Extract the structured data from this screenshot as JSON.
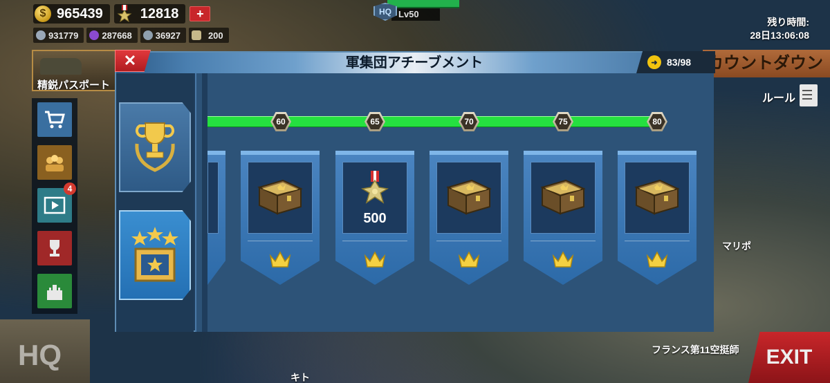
{
  "top": {
    "gold": "965439",
    "medals": "12818",
    "plus": "+",
    "res1": "931779",
    "res2": "287668",
    "res3": "36927",
    "res4": "200",
    "hq_label": "HQ",
    "hq_level": "Lv50",
    "timer_label": "残り時間:",
    "timer_value": "28日13:06:08"
  },
  "side": {
    "promo_label": "精鋭パスポート",
    "badge_count": "4",
    "countdown": "カウントダウン",
    "rule": "ルール"
  },
  "panel": {
    "title": "軍集団アチーブメント",
    "close": "✕",
    "score": "83/98"
  },
  "milestones": [
    "60",
    "65",
    "70",
    "75",
    "80"
  ],
  "rewards": [
    {
      "type": "chest-icon",
      "amount": ""
    },
    {
      "type": "medal-icon",
      "amount": "500"
    },
    {
      "type": "chest-icon",
      "amount": ""
    },
    {
      "type": "chest-icon",
      "amount": ""
    },
    {
      "type": "chest-icon",
      "amount": ""
    }
  ],
  "map": {
    "hq_big": "HQ",
    "exit": "EXIT",
    "place1": "フランス第11空挺師",
    "place2": "キト",
    "place3": "マリポ"
  },
  "colors": {
    "progress": "#25e040",
    "card": "#3a78b4",
    "close": "#d32f2f",
    "accent_gold": "#f1c40f"
  }
}
